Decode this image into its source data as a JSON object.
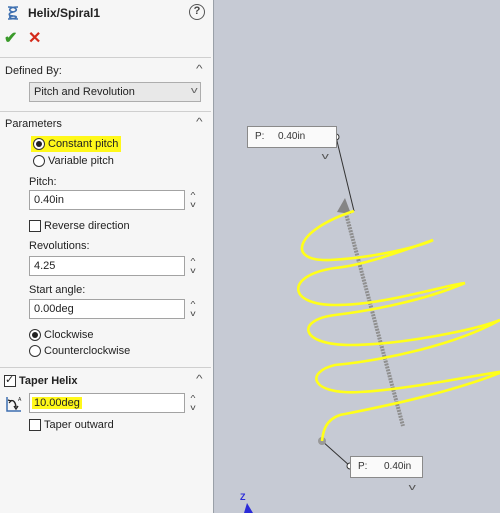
{
  "title": "Helix/Spiral1",
  "icons": {
    "feature": "helix-icon",
    "help": "help-icon",
    "ok": "checkmark-icon",
    "cancel": "close-icon"
  },
  "glyphs": {
    "help": "?",
    "ok": "✔",
    "cancel": "✕",
    "collapse": "^",
    "dropdown": "v"
  },
  "defined_by": {
    "title": "Defined By:",
    "selected": "Pitch and Revolution"
  },
  "parameters": {
    "title": "Parameters",
    "constant_pitch": "Constant pitch",
    "variable_pitch": "Variable pitch",
    "pitch_mode": "constant",
    "pitch_label": "Pitch:",
    "pitch_value": "0.40in",
    "reverse_direction": "Reverse direction",
    "reverse_checked": false,
    "revolutions_label": "Revolutions:",
    "revolutions_value": "4.25",
    "start_angle_label": "Start angle:",
    "start_angle_value": "0.00deg",
    "clockwise": "Clockwise",
    "counterclockwise": "Counterclockwise",
    "direction": "clockwise"
  },
  "taper": {
    "title": "Taper Helix",
    "enabled": true,
    "angle_value": "10.00deg",
    "taper_outward": "Taper outward",
    "outward_checked": false
  },
  "viewport": {
    "callout_top": {
      "label": "P:",
      "value": "0.40in"
    },
    "callout_bottom": {
      "label": "P:",
      "value": "0.40in"
    },
    "triad_axis": "Z",
    "helix_color": "#ffff1a"
  },
  "colors": {
    "highlight": "#fff81a",
    "ok": "#3a9a2a",
    "cancel": "#d42a1a",
    "viewport_bg": "#c6cad4"
  }
}
